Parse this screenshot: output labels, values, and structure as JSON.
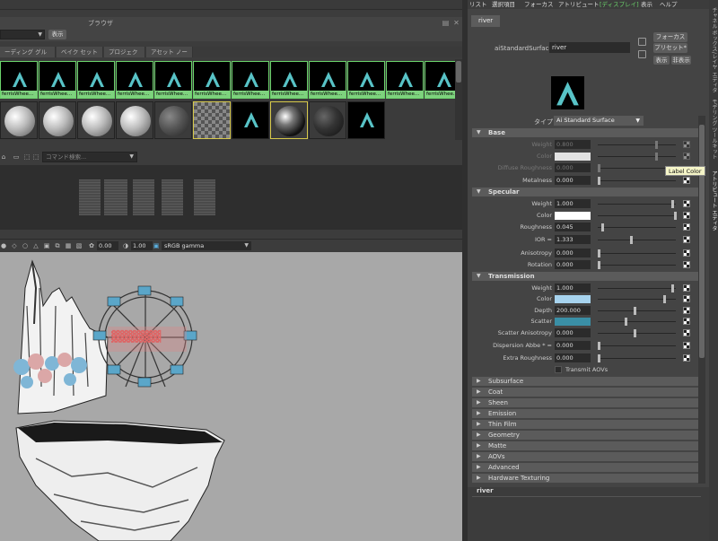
{
  "browser": {
    "title": "ブラウザ",
    "show_label": "表示",
    "tabs": [
      "ーディング グループ",
      "ベイク セット",
      "プロジェクト",
      "アセット ノード"
    ],
    "swatch_label": "ferrisWhee..."
  },
  "command": {
    "placeholder": "コマンド検索..."
  },
  "viewport_bar": {
    "exposure": "0.00",
    "gamma": "1.00",
    "color_space": "sRGB gamma"
  },
  "ae": {
    "menu": [
      "リスト",
      "選択項目",
      "フォーカス",
      "アトリビュート",
      "[ディスプレイ]",
      "表示",
      "ヘルプ"
    ],
    "node_tab": "river",
    "node_type_label": "aiStandardSurface:",
    "node_name": "river",
    "focus_btn": "フォーカス",
    "preset_btn": "プリセット*",
    "show_btn": "表示",
    "hide_btn": "非表示",
    "type_label": "タイプ",
    "type_value": "Ai Standard Surface",
    "sections": {
      "base": "Base",
      "specular": "Specular",
      "transmission": "Transmission"
    },
    "base": {
      "weight": {
        "label": "Weight",
        "value": "0.800"
      },
      "color": {
        "label": "Color"
      },
      "diffuse_roughness": {
        "label": "Diffuse Roughness",
        "value": "0.000"
      },
      "metalness": {
        "label": "Metalness",
        "value": "0.000"
      }
    },
    "specular": {
      "weight": {
        "label": "Weight",
        "value": "1.000"
      },
      "color": {
        "label": "Color"
      },
      "roughness": {
        "label": "Roughness",
        "value": "0.045"
      },
      "ior": {
        "label": "IOR",
        "value": "1.333"
      },
      "anisotropy": {
        "label": "Anisotropy",
        "value": "0.000"
      },
      "rotation": {
        "label": "Rotation",
        "value": "0.000"
      }
    },
    "transmission": {
      "weight": {
        "label": "Weight",
        "value": "1.000"
      },
      "color": {
        "label": "Color"
      },
      "depth": {
        "label": "Depth",
        "value": "200.000"
      },
      "scatter": {
        "label": "Scatter"
      },
      "scatter_anisotropy": {
        "label": "Scatter Anisotropy",
        "value": "0.000"
      },
      "dispersion_abbe": {
        "label": "Dispersion Abbe * =",
        "value": "0.000"
      },
      "extra_roughness": {
        "label": "Extra Roughness",
        "value": "0.000"
      },
      "transmit_aovs": {
        "label": "Transmit AOVs"
      }
    },
    "collapsed_sections": [
      "Subsurface",
      "Coat",
      "Sheen",
      "Emission",
      "Thin Film",
      "Geometry",
      "Matte",
      "AOVs",
      "Advanced",
      "Hardware Texturing"
    ],
    "bottom_node": "river",
    "tooltip": "Label Color"
  },
  "vertical_tabs": [
    "チャネル ボックス/レイヤ エディタ",
    "モデリング ツールキット",
    "アトリビュート エディタ"
  ],
  "colors": {
    "base_color": "#e2e2e2",
    "spec_color": "#ffffff",
    "trans_color": "#a7d3ee",
    "scatter_color": "#3a8fa6",
    "logo": "#58c3c7",
    "selected": "#6bd36b"
  }
}
